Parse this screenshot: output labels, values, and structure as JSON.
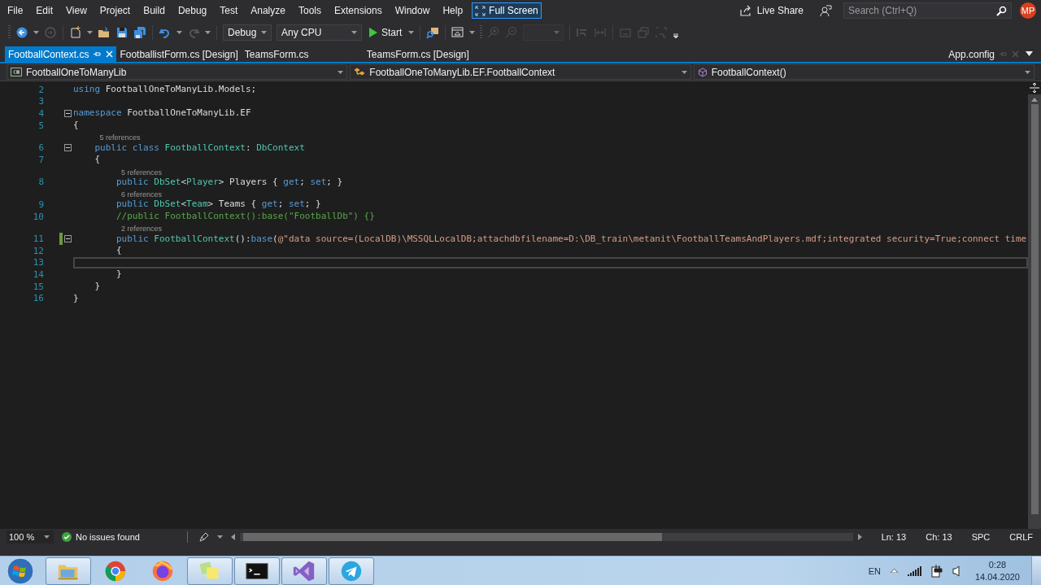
{
  "menu": {
    "items": [
      "File",
      "Edit",
      "View",
      "Project",
      "Build",
      "Debug",
      "Test",
      "Analyze",
      "Tools",
      "Extensions",
      "Window",
      "Help"
    ],
    "full_screen": {
      "label": "Full Screen",
      "selected": true
    }
  },
  "header": {
    "live_share": "Live Share",
    "search": {
      "placeholder": "Search (Ctrl+Q)"
    },
    "avatar": "MP"
  },
  "toolbar": {
    "configuration": "Debug",
    "platform": "Any CPU",
    "start": "Start"
  },
  "tabs": [
    {
      "label": "FootballContext.cs",
      "selected": true
    },
    {
      "label": "FootballistForm.cs [Design]",
      "selected": false
    },
    {
      "label": "TeamsForm.cs",
      "selected": false
    },
    {
      "label": "TeamsForm.cs [Design]",
      "selected": false
    }
  ],
  "right_tab": {
    "label": "App.config"
  },
  "navigation": {
    "project": "FootballOneToManyLib",
    "type": "FootballOneToManyLib.EF.FootballContext",
    "member": "FootballContext()"
  },
  "editor": {
    "lines": [
      {
        "number": "2",
        "fold": false,
        "modified": false,
        "current": false,
        "tokens": [
          {
            "kind": "kw",
            "text": "using"
          },
          {
            "kind": "plain",
            "text": " FootballOneToManyLib.Models;"
          }
        ]
      },
      {
        "number": "3",
        "fold": false,
        "modified": false,
        "current": false
      },
      {
        "number": "4",
        "fold": true,
        "modified": false,
        "current": false,
        "tokens": [
          {
            "kind": "kw",
            "text": "namespace"
          },
          {
            "kind": "plain",
            "text": " FootballOneToManyLib.EF"
          }
        ]
      },
      {
        "number": "5",
        "fold": false,
        "modified": false,
        "current": false,
        "tokens": [
          {
            "kind": "plain",
            "text": "{"
          }
        ]
      },
      {
        "number": "6",
        "lens": "5 references",
        "fold": true,
        "modified": false,
        "current": false,
        "tokens": [
          {
            "kind": "kw",
            "text": "    public class "
          },
          {
            "kind": "type",
            "text": "FootballContext"
          },
          {
            "kind": "plain",
            "text": ": "
          },
          {
            "kind": "type",
            "text": "DbContext"
          }
        ]
      },
      {
        "number": "7",
        "fold": false,
        "modified": false,
        "current": false,
        "tokens": [
          {
            "kind": "plain",
            "text": "    {"
          }
        ]
      },
      {
        "number": "8",
        "lens": "5 references",
        "fold": false,
        "modified": false,
        "current": false,
        "tokens": [
          {
            "kind": "kw",
            "text": "        public "
          },
          {
            "kind": "type",
            "text": "DbSet"
          },
          {
            "kind": "plain",
            "text": "<"
          },
          {
            "kind": "type",
            "text": "Player"
          },
          {
            "kind": "plain",
            "text": "> Players { "
          },
          {
            "kind": "kw",
            "text": "get"
          },
          {
            "kind": "plain",
            "text": "; "
          },
          {
            "kind": "kw",
            "text": "set"
          },
          {
            "kind": "plain",
            "text": "; }"
          }
        ]
      },
      {
        "number": "9",
        "lens": "6 references",
        "fold": false,
        "modified": false,
        "current": false,
        "tokens": [
          {
            "kind": "kw",
            "text": "        public "
          },
          {
            "kind": "type",
            "text": "DbSet"
          },
          {
            "kind": "plain",
            "text": "<"
          },
          {
            "kind": "type",
            "text": "Team"
          },
          {
            "kind": "plain",
            "text": "> Teams { "
          },
          {
            "kind": "kw",
            "text": "get"
          },
          {
            "kind": "plain",
            "text": "; "
          },
          {
            "kind": "kw",
            "text": "set"
          },
          {
            "kind": "plain",
            "text": "; }"
          }
        ]
      },
      {
        "number": "10",
        "fold": false,
        "modified": false,
        "current": false,
        "tokens": [
          {
            "kind": "comment",
            "text": "        //public FootballContext():base(\"FootballDb\") {}"
          }
        ]
      },
      {
        "number": "11",
        "lens": "2 references",
        "fold": true,
        "modified": true,
        "current": false,
        "tokens": [
          {
            "kind": "kw",
            "text": "        public "
          },
          {
            "kind": "type",
            "text": "FootballContext"
          },
          {
            "kind": "plain",
            "text": "():"
          },
          {
            "kind": "kw",
            "text": "base"
          },
          {
            "kind": "plain",
            "text": "("
          },
          {
            "kind": "str",
            "text": "@\"data source=(LocalDB)\\MSSQLLocalDB;attachdbfilename=D:\\DB_train\\metanit\\FootballTeamsAndPlayers.mdf;integrated security=True;connect time"
          }
        ]
      },
      {
        "number": "12",
        "fold": false,
        "modified": false,
        "current": false,
        "tokens": [
          {
            "kind": "plain",
            "text": "        {"
          }
        ]
      },
      {
        "number": "13",
        "fold": false,
        "modified": false,
        "current": true
      },
      {
        "number": "14",
        "fold": false,
        "modified": false,
        "current": false,
        "tokens": [
          {
            "kind": "plain",
            "text": "        }"
          }
        ]
      },
      {
        "number": "15",
        "fold": false,
        "modified": false,
        "current": false,
        "tokens": [
          {
            "kind": "plain",
            "text": "    }"
          }
        ]
      },
      {
        "number": "16",
        "fold": false,
        "modified": false,
        "current": false,
        "tokens": [
          {
            "kind": "plain",
            "text": "}"
          }
        ]
      }
    ]
  },
  "status_bar": {
    "zoom": "100 %",
    "issues": "No issues found",
    "line": "Ln: 13",
    "column": "Ch: 13",
    "indent": "SPC",
    "line_endings": "CRLF"
  },
  "taskbar": {
    "apps": [
      {
        "kind": "explorer",
        "running": true
      },
      {
        "kind": "chrome",
        "running": false
      },
      {
        "kind": "firefox",
        "running": false
      },
      {
        "kind": "notes",
        "running": true
      },
      {
        "kind": "console",
        "running": true
      },
      {
        "kind": "studio",
        "running": true
      },
      {
        "kind": "telegram",
        "running": true
      }
    ],
    "language": "EN",
    "time": "0:28",
    "date": "14.04.2020"
  }
}
